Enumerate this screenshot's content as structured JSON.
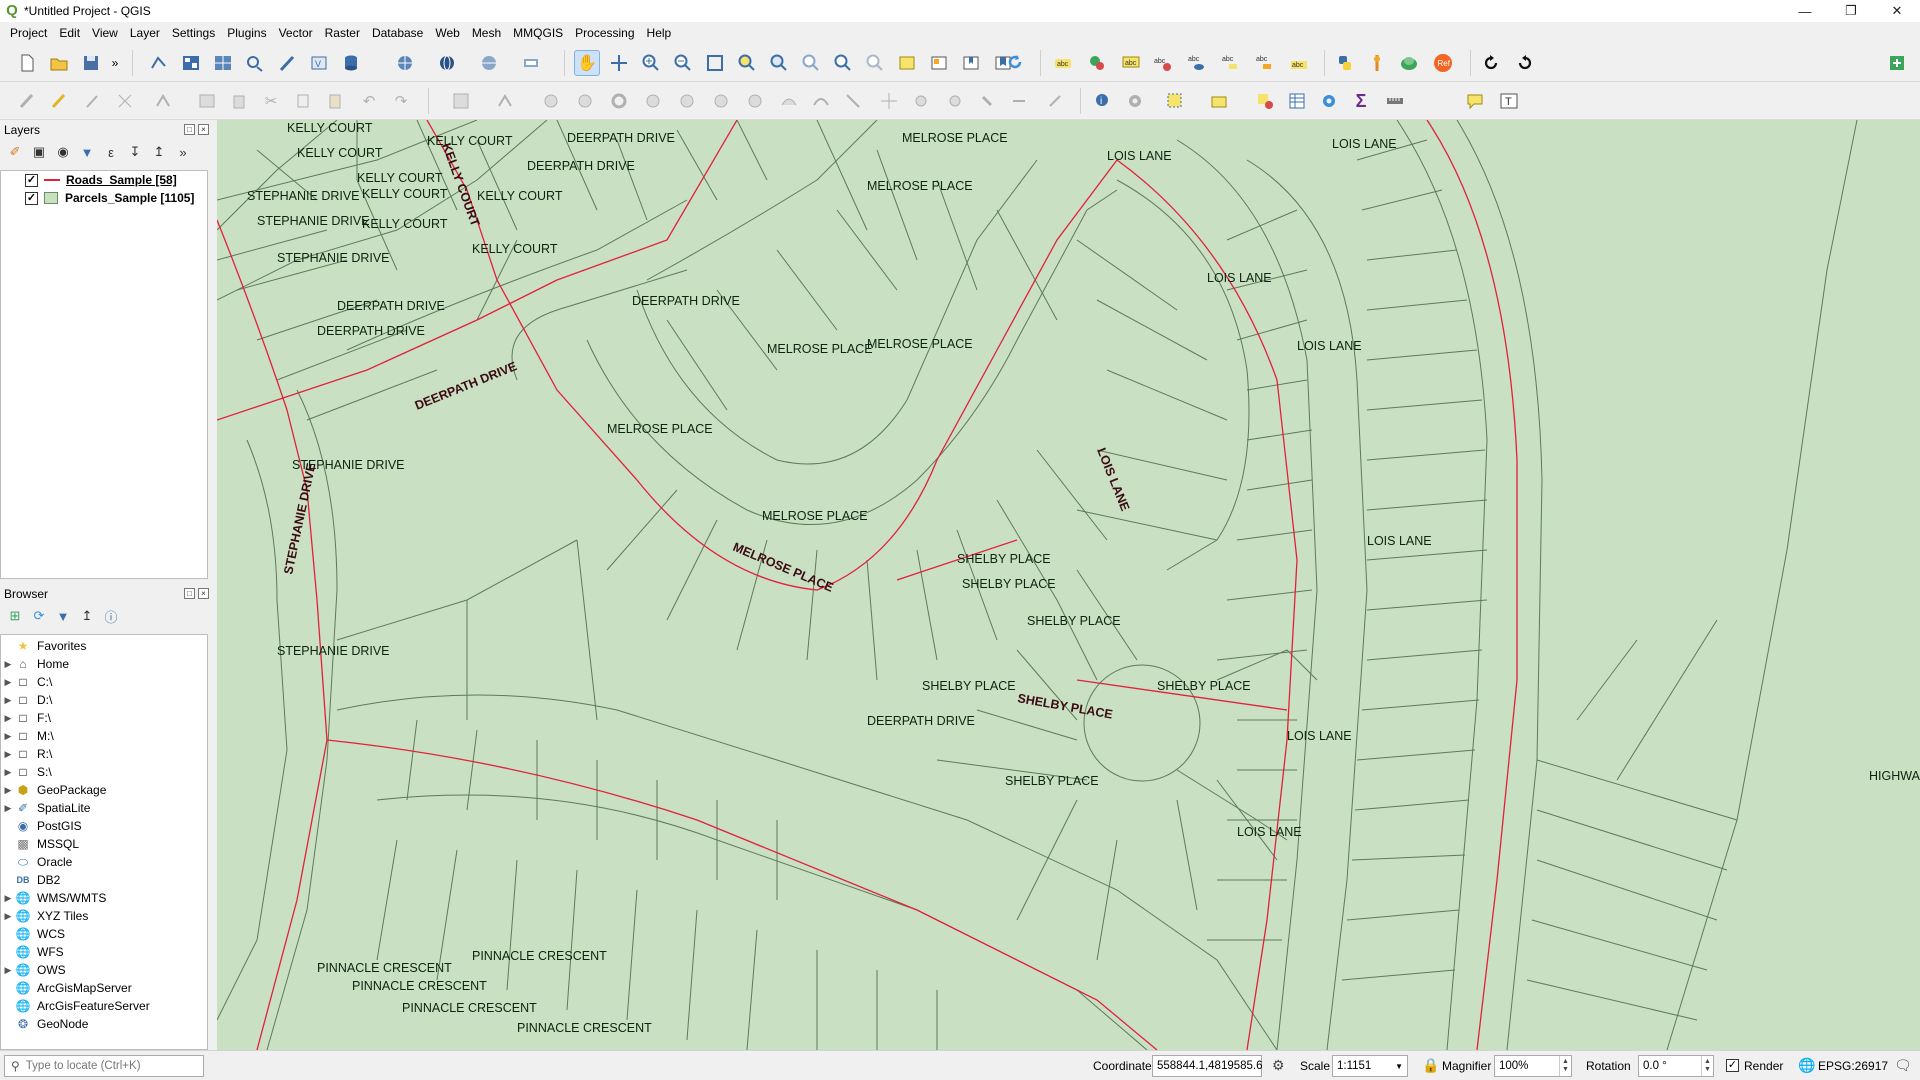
{
  "window": {
    "title": "*Untitled Project - QGIS",
    "controls": [
      "minimize",
      "maximize",
      "close"
    ]
  },
  "menubar": {
    "items": [
      "Project",
      "Edit",
      "View",
      "Layer",
      "Settings",
      "Plugins",
      "Vector",
      "Raster",
      "Database",
      "Web",
      "Mesh",
      "MMQGIS",
      "Processing",
      "Help"
    ]
  },
  "layers_panel": {
    "title": "Layers",
    "layers": [
      {
        "name": "Roads_Sample [58]",
        "visible": true,
        "symbol": "line",
        "color": "#e2203b",
        "active": true
      },
      {
        "name": "Parcels_Sample [1105]",
        "visible": true,
        "symbol": "polygon",
        "color": "#c8dfc0",
        "active": false
      }
    ]
  },
  "browser_panel": {
    "title": "Browser",
    "items": [
      {
        "label": "Favorites",
        "icon": "star-icon",
        "expandable": false
      },
      {
        "label": "Home",
        "icon": "folder-icon",
        "expandable": true
      },
      {
        "label": "C:\\",
        "icon": "drive-icon",
        "expandable": true
      },
      {
        "label": "D:\\",
        "icon": "drive-icon",
        "expandable": true
      },
      {
        "label": "F:\\",
        "icon": "drive-icon",
        "expandable": true
      },
      {
        "label": "M:\\",
        "icon": "drive-icon",
        "expandable": true
      },
      {
        "label": "R:\\",
        "icon": "drive-icon",
        "expandable": true
      },
      {
        "label": "S:\\",
        "icon": "drive-icon",
        "expandable": true
      },
      {
        "label": "GeoPackage",
        "icon": "geopackage-icon",
        "expandable": true
      },
      {
        "label": "SpatiaLite",
        "icon": "spatialite-icon",
        "expandable": true
      },
      {
        "label": "PostGIS",
        "icon": "postgis-icon",
        "expandable": false
      },
      {
        "label": "MSSQL",
        "icon": "mssql-icon",
        "expandable": false
      },
      {
        "label": "Oracle",
        "icon": "oracle-icon",
        "expandable": false
      },
      {
        "label": "DB2",
        "icon": "db2-icon",
        "expandable": false
      },
      {
        "label": "WMS/WMTS",
        "icon": "globe-icon",
        "expandable": true
      },
      {
        "label": "XYZ Tiles",
        "icon": "xyz-tiles-icon",
        "expandable": true
      },
      {
        "label": "WCS",
        "icon": "globe-icon",
        "expandable": false
      },
      {
        "label": "WFS",
        "icon": "globe-icon",
        "expandable": false
      },
      {
        "label": "OWS",
        "icon": "globe-icon",
        "expandable": true
      },
      {
        "label": "ArcGisMapServer",
        "icon": "arcgis-icon",
        "expandable": false
      },
      {
        "label": "ArcGisFeatureServer",
        "icon": "arcgis-icon",
        "expandable": false
      },
      {
        "label": "GeoNode",
        "icon": "geonode-icon",
        "expandable": false
      }
    ]
  },
  "map": {
    "background": "#c9e0c2",
    "parcel_stroke": "#5e7a5a",
    "road_color": "#e2203b",
    "parcel_labels": [
      "KELLY COURT",
      "KELLY COURT",
      "KELLY COURT",
      "KELLY COURT",
      "KELLY COURT",
      "KELLY COURT",
      "KELLY COURT",
      "KELLY COURT",
      "DEERPATH DRIVE",
      "DEERPATH DRIVE",
      "DEERPATH DRIVE",
      "DEERPATH DRIVE",
      "DEERPATH DRIVE",
      "DEERPATH DRIVE",
      "MELROSE PLACE",
      "MELROSE PLACE",
      "MELROSE PLACE",
      "MELROSE PLACE",
      "MELROSE PLACE",
      "MELROSE PLACE",
      "STEPHANIE DRIVE",
      "STEPHANIE DRIVE",
      "STEPHANIE DRIVE",
      "STEPHANIE DRIVE",
      "STEPHANIE DRIVE",
      "LOIS LANE",
      "LOIS LANE",
      "LOIS LANE",
      "LOIS LANE",
      "LOIS LANE",
      "LOIS LANE",
      "LOIS LANE",
      "SHELBY PLACE",
      "SHELBY PLACE",
      "SHELBY PLACE",
      "SHELBY PLACE",
      "SHELBY PLACE",
      "SHELBY PLACE",
      "PINNACLE CRESCENT",
      "PINNACLE CRESCENT",
      "PINNACLE CRESCENT",
      "PINNACLE CRESCENT",
      "PINNACLE CRESCENT",
      "HIGHWA"
    ],
    "road_labels": [
      "DEERPATH DRIVE",
      "STEPHANIE DRIVE",
      "KELLY COURT",
      "MELROSE PLACE",
      "SHELBY PLACE",
      "LOIS LANE"
    ]
  },
  "statusbar": {
    "locator_placeholder": "Type to locate (Ctrl+K)",
    "coordinate_label": "Coordinate",
    "coordinate_value": "558844.1,4819585.6",
    "scale_label": "Scale",
    "scale_value": "1:1151",
    "magnifier_label": "Magnifier",
    "magnifier_value": "100%",
    "rotation_label": "Rotation",
    "rotation_value": "0.0 °",
    "render_label": "Render",
    "render_checked": true,
    "crs_label": "EPSG:26917"
  }
}
